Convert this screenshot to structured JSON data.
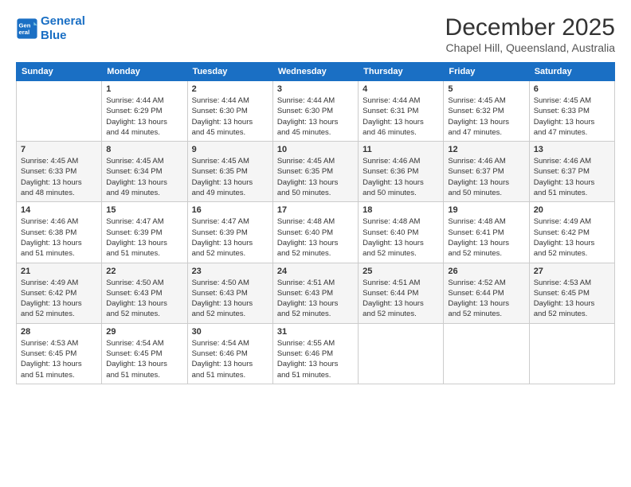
{
  "header": {
    "logo_line1": "General",
    "logo_line2": "Blue",
    "month_title": "December 2025",
    "subtitle": "Chapel Hill, Queensland, Australia"
  },
  "weekdays": [
    "Sunday",
    "Monday",
    "Tuesday",
    "Wednesday",
    "Thursday",
    "Friday",
    "Saturday"
  ],
  "weeks": [
    [
      {
        "day": "",
        "info": ""
      },
      {
        "day": "1",
        "info": "Sunrise: 4:44 AM\nSunset: 6:29 PM\nDaylight: 13 hours\nand 44 minutes."
      },
      {
        "day": "2",
        "info": "Sunrise: 4:44 AM\nSunset: 6:30 PM\nDaylight: 13 hours\nand 45 minutes."
      },
      {
        "day": "3",
        "info": "Sunrise: 4:44 AM\nSunset: 6:30 PM\nDaylight: 13 hours\nand 45 minutes."
      },
      {
        "day": "4",
        "info": "Sunrise: 4:44 AM\nSunset: 6:31 PM\nDaylight: 13 hours\nand 46 minutes."
      },
      {
        "day": "5",
        "info": "Sunrise: 4:45 AM\nSunset: 6:32 PM\nDaylight: 13 hours\nand 47 minutes."
      },
      {
        "day": "6",
        "info": "Sunrise: 4:45 AM\nSunset: 6:33 PM\nDaylight: 13 hours\nand 47 minutes."
      }
    ],
    [
      {
        "day": "7",
        "info": "Sunrise: 4:45 AM\nSunset: 6:33 PM\nDaylight: 13 hours\nand 48 minutes."
      },
      {
        "day": "8",
        "info": "Sunrise: 4:45 AM\nSunset: 6:34 PM\nDaylight: 13 hours\nand 49 minutes."
      },
      {
        "day": "9",
        "info": "Sunrise: 4:45 AM\nSunset: 6:35 PM\nDaylight: 13 hours\nand 49 minutes."
      },
      {
        "day": "10",
        "info": "Sunrise: 4:45 AM\nSunset: 6:35 PM\nDaylight: 13 hours\nand 50 minutes."
      },
      {
        "day": "11",
        "info": "Sunrise: 4:46 AM\nSunset: 6:36 PM\nDaylight: 13 hours\nand 50 minutes."
      },
      {
        "day": "12",
        "info": "Sunrise: 4:46 AM\nSunset: 6:37 PM\nDaylight: 13 hours\nand 50 minutes."
      },
      {
        "day": "13",
        "info": "Sunrise: 4:46 AM\nSunset: 6:37 PM\nDaylight: 13 hours\nand 51 minutes."
      }
    ],
    [
      {
        "day": "14",
        "info": "Sunrise: 4:46 AM\nSunset: 6:38 PM\nDaylight: 13 hours\nand 51 minutes."
      },
      {
        "day": "15",
        "info": "Sunrise: 4:47 AM\nSunset: 6:39 PM\nDaylight: 13 hours\nand 51 minutes."
      },
      {
        "day": "16",
        "info": "Sunrise: 4:47 AM\nSunset: 6:39 PM\nDaylight: 13 hours\nand 52 minutes."
      },
      {
        "day": "17",
        "info": "Sunrise: 4:48 AM\nSunset: 6:40 PM\nDaylight: 13 hours\nand 52 minutes."
      },
      {
        "day": "18",
        "info": "Sunrise: 4:48 AM\nSunset: 6:40 PM\nDaylight: 13 hours\nand 52 minutes."
      },
      {
        "day": "19",
        "info": "Sunrise: 4:48 AM\nSunset: 6:41 PM\nDaylight: 13 hours\nand 52 minutes."
      },
      {
        "day": "20",
        "info": "Sunrise: 4:49 AM\nSunset: 6:42 PM\nDaylight: 13 hours\nand 52 minutes."
      }
    ],
    [
      {
        "day": "21",
        "info": "Sunrise: 4:49 AM\nSunset: 6:42 PM\nDaylight: 13 hours\nand 52 minutes."
      },
      {
        "day": "22",
        "info": "Sunrise: 4:50 AM\nSunset: 6:43 PM\nDaylight: 13 hours\nand 52 minutes."
      },
      {
        "day": "23",
        "info": "Sunrise: 4:50 AM\nSunset: 6:43 PM\nDaylight: 13 hours\nand 52 minutes."
      },
      {
        "day": "24",
        "info": "Sunrise: 4:51 AM\nSunset: 6:43 PM\nDaylight: 13 hours\nand 52 minutes."
      },
      {
        "day": "25",
        "info": "Sunrise: 4:51 AM\nSunset: 6:44 PM\nDaylight: 13 hours\nand 52 minutes."
      },
      {
        "day": "26",
        "info": "Sunrise: 4:52 AM\nSunset: 6:44 PM\nDaylight: 13 hours\nand 52 minutes."
      },
      {
        "day": "27",
        "info": "Sunrise: 4:53 AM\nSunset: 6:45 PM\nDaylight: 13 hours\nand 52 minutes."
      }
    ],
    [
      {
        "day": "28",
        "info": "Sunrise: 4:53 AM\nSunset: 6:45 PM\nDaylight: 13 hours\nand 51 minutes."
      },
      {
        "day": "29",
        "info": "Sunrise: 4:54 AM\nSunset: 6:45 PM\nDaylight: 13 hours\nand 51 minutes."
      },
      {
        "day": "30",
        "info": "Sunrise: 4:54 AM\nSunset: 6:46 PM\nDaylight: 13 hours\nand 51 minutes."
      },
      {
        "day": "31",
        "info": "Sunrise: 4:55 AM\nSunset: 6:46 PM\nDaylight: 13 hours\nand 51 minutes."
      },
      {
        "day": "",
        "info": ""
      },
      {
        "day": "",
        "info": ""
      },
      {
        "day": "",
        "info": ""
      }
    ]
  ]
}
